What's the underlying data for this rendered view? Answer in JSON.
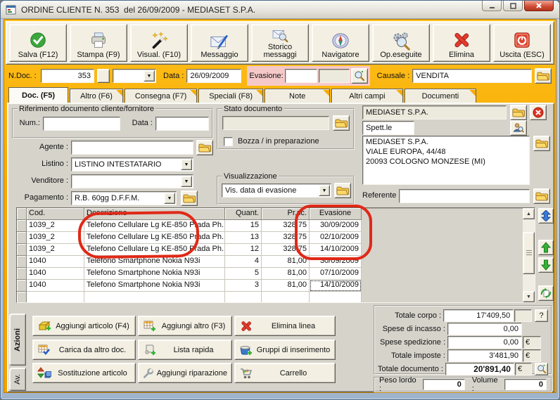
{
  "window": {
    "title": "ORDINE CLIENTE N. 353  del 26/09/2009 - MEDIASET S.P.A."
  },
  "colors": {
    "accent_orange": "#F6AB00",
    "pink_highlight": "#F6C9C9",
    "annotation_red": "#E02817",
    "panel_gray": "#D6D3CB"
  },
  "icons": {
    "arrow_down": "▼",
    "arrow_up": "▲"
  },
  "toolbar": {
    "buttons": [
      {
        "label": "Salva (F12)"
      },
      {
        "label": "Stampa (F9)"
      },
      {
        "label": "Visual. (F10)"
      },
      {
        "label": "Messaggio"
      },
      {
        "label": "Storico messaggi"
      },
      {
        "label": "Navigatore"
      },
      {
        "label": "Op.eseguite"
      },
      {
        "label": "Elimina"
      },
      {
        "label": "Uscita (ESC)"
      }
    ]
  },
  "doc_header": {
    "ndoc_label": "N.Doc. :",
    "ndoc_value": "353",
    "data_label": "Data :",
    "data_value": "26/09/2009",
    "evasione_label": "Evasione:",
    "evasione_value": "",
    "causale_label": "Causale :",
    "causale_value": "VENDITA"
  },
  "tabs": [
    {
      "label": "Doc. (F5)"
    },
    {
      "label": "Altro (F6)"
    },
    {
      "label": "Consegna (F7)"
    },
    {
      "label": "Speciali (F8)"
    },
    {
      "label": "Note"
    },
    {
      "label": "Altri campi"
    },
    {
      "label": "Documenti"
    }
  ],
  "form": {
    "riferimento_legend": "Riferimento documento cliente/fornitore",
    "num_label": "Num.:",
    "num_value": "",
    "rif_data_label": "Data :",
    "rif_data_value": "",
    "agente_label": "Agente :",
    "agente_value": "",
    "listino_label": "Listino :",
    "listino_value": "LISTINO INTESTATARIO",
    "venditore_label": "Venditore :",
    "venditore_value": "",
    "pagamento_label": "Pagamento :",
    "pagamento_value": "R.B. 60gg D.F.F.M.",
    "stato_legend": "Stato documento",
    "stato_value": "",
    "bozza_label": "Bozza / in preparazione",
    "vis_legend": "Visualizzazione",
    "vis_value": "Vis. data di evasione"
  },
  "customer": {
    "name": "MEDIASET S.P.A.",
    "salutation": "Spett.le",
    "address": "MEDIASET S.P.A.\nVIALE EUROPA, 44/48\n20093 COLOGNO MONZESE (MI)",
    "referente_label": "Referente",
    "referente_value": ""
  },
  "grid": {
    "columns": [
      "Cod.",
      "Descrizione",
      "Quant.",
      "Pr.sc.",
      "Evasione"
    ],
    "rows": [
      [
        "1039_2",
        "Telefono Cellulare Lg KE-850 Prada Ph...",
        "15",
        "328,75",
        "30/09/2009"
      ],
      [
        "1039_2",
        "Telefono Cellulare Lg KE-850 Prada Ph...",
        "13",
        "328,75",
        "02/10/2009"
      ],
      [
        "1039_2",
        "Telefono Cellulare Lg KE-850 Prada Ph...",
        "12",
        "328,75",
        "14/10/2009"
      ],
      [
        "1040",
        "Telefono Smartphone Nokia N93i",
        "4",
        "81,00",
        "30/09/2009"
      ],
      [
        "1040",
        "Telefono Smartphone Nokia N93i",
        "5",
        "81,00",
        "07/10/2009"
      ],
      [
        "1040",
        "Telefono Smartphone Nokia N93i",
        "3",
        "81,00",
        "14/10/2009"
      ]
    ]
  },
  "actions": {
    "tab_azioni": "Azioni",
    "tab_av": "Av.",
    "buttons": [
      {
        "label": "Aggiungi articolo (F4)"
      },
      {
        "label": "Aggiungi altro (F3)"
      },
      {
        "label": "Elimina linea"
      },
      {
        "label": "Carica da altro doc."
      },
      {
        "label": "Lista rapida"
      },
      {
        "label": "Gruppi di inserimento"
      },
      {
        "label": "Sostituzione articolo"
      },
      {
        "label": "Aggiungi riparazione"
      },
      {
        "label": "Carrello"
      }
    ]
  },
  "totals": {
    "rows": [
      {
        "label": "Totale corpo :",
        "value": "17'409,50",
        "currency": ""
      },
      {
        "label": "Spese di incasso :",
        "value": "0,00",
        "currency": ""
      },
      {
        "label": "Spese spedizione :",
        "value": "0,00",
        "currency": "€"
      },
      {
        "label": "Totale imposte :",
        "value": "3'481,90",
        "currency": "€"
      },
      {
        "label": "Totale documento :",
        "value": "20'891,40",
        "currency": "€"
      }
    ],
    "help_label": "?",
    "peso_label": "Peso lordo :",
    "peso_value": "0",
    "volume_label": "Volume :",
    "volume_value": "0"
  }
}
